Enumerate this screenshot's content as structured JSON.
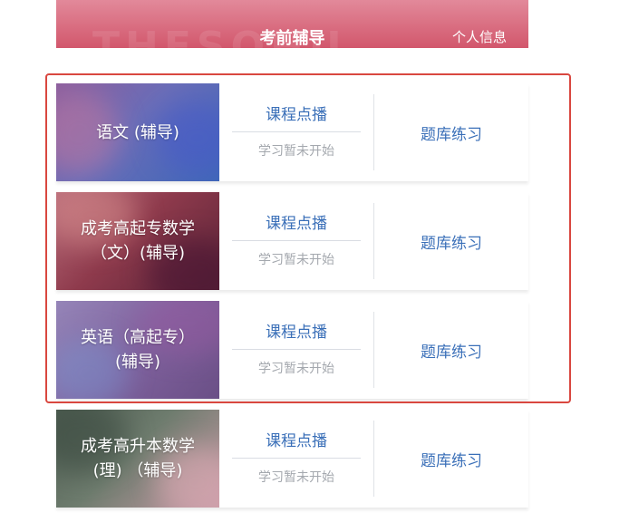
{
  "header": {
    "title": "考前辅导",
    "profile_link": "个人信息",
    "background": "#d9687c"
  },
  "highlight_color": "#d9473f",
  "courses": [
    {
      "name": "语文 (辅导)",
      "video_label": "课程点播",
      "status": "学习暂未开始",
      "practice_label": "题库练习"
    },
    {
      "name": "成考高起专数学\n（文）(辅导)",
      "video_label": "课程点播",
      "status": "学习暂未开始",
      "practice_label": "题库练习"
    },
    {
      "name": "英语（高起专）\n(辅导)",
      "video_label": "课程点播",
      "status": "学习暂未开始",
      "practice_label": "题库练习"
    },
    {
      "name": "成考高升本数学\n(理) （辅导)",
      "video_label": "课程点播",
      "status": "学习暂未开始",
      "practice_label": "题库练习"
    }
  ],
  "colors": {
    "link": "#3a6fb8",
    "muted": "#a4a8ae"
  }
}
